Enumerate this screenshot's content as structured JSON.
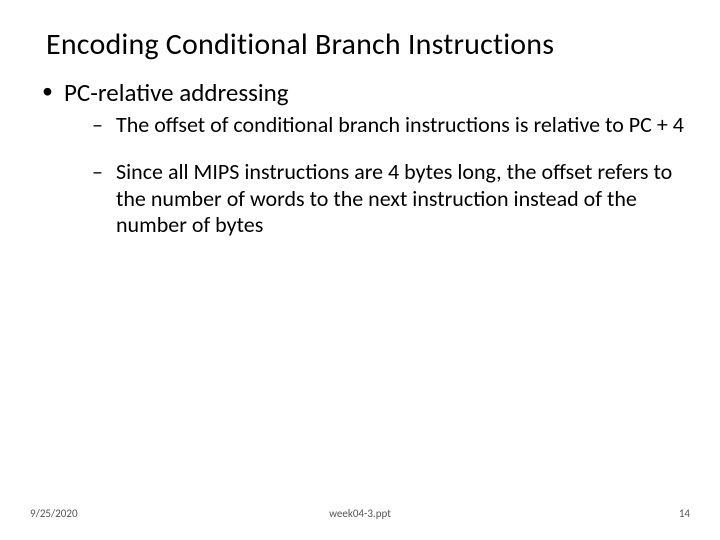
{
  "title": "Encoding Conditional Branch Instructions",
  "bullets": {
    "main": "PC-relative addressing",
    "sub1": "The offset of conditional branch instructions is relative to PC + 4",
    "sub2": "Since all MIPS instructions are 4 bytes long, the offset refers to the number of words to the next instruction instead of the number of bytes"
  },
  "footer": {
    "date": "9/25/2020",
    "file": "week04-3.ppt",
    "page": "14"
  }
}
